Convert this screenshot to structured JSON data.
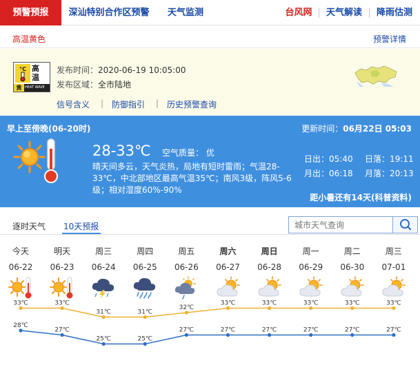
{
  "nav": {
    "items": [
      "预警预报",
      "深汕特别合作区预警",
      "天气监测",
      "台风网",
      "天气解读",
      "降雨估测"
    ]
  },
  "alert": {
    "tab": "高温黄色",
    "detail_link": "预警详情",
    "badge": {
      "title_line1": "高",
      "title_line2": "温",
      "level": "黄",
      "english": "HEAT WAVE",
      "therm": "°C"
    },
    "publish_time_label": "发布时间：",
    "publish_time": "2020-06-19 10:05:00",
    "area_label": "发布区域：",
    "area": "全市陆地",
    "links": [
      "信号含义",
      "防御指引",
      "历史预警查询"
    ]
  },
  "today": {
    "period": "早上至傍晚(06-20时)",
    "updated_label": "更新时间：",
    "updated": "06月22日 05:03",
    "temp": "28-33℃",
    "air_quality": "空气质量： 优",
    "description": "晴天间多云，天气炎热，局地有短时雷雨；气温28-33℃，中北部地区最高气温35℃；南风3级，阵风5-6级；相对湿度60%-90%",
    "sunrise": "日出：05:40",
    "sunset": "日落：19:11",
    "moonrise": "月出：06:18",
    "moonset": "月落：20:13",
    "tip": "距小暑还有14天(科普资料)"
  },
  "forecast": {
    "tabs": [
      "逐时天气",
      "10天预报"
    ],
    "search_placeholder": "城市天气查询",
    "days": [
      {
        "name": "今天",
        "date": "06-22",
        "icon": "sunny-hot-icon",
        "bold": false
      },
      {
        "name": "明天",
        "date": "06-23",
        "icon": "sunny-hot-icon",
        "bold": false
      },
      {
        "name": "周三",
        "date": "06-24",
        "icon": "thunderstorm-icon",
        "bold": false
      },
      {
        "name": "周四",
        "date": "06-25",
        "icon": "rain-icon",
        "bold": false
      },
      {
        "name": "周五",
        "date": "06-26",
        "icon": "partly-cloudy-shower-icon",
        "bold": false
      },
      {
        "name": "周六",
        "date": "06-27",
        "icon": "partly-cloudy-icon",
        "bold": true
      },
      {
        "name": "周日",
        "date": "06-28",
        "icon": "partly-cloudy-icon",
        "bold": true
      },
      {
        "name": "周一",
        "date": "06-29",
        "icon": "partly-cloudy-icon",
        "bold": false
      },
      {
        "name": "周二",
        "date": "06-30",
        "icon": "partly-cloudy-icon",
        "bold": false
      },
      {
        "name": "周三",
        "date": "07-01",
        "icon": "partly-cloudy-icon",
        "bold": false
      }
    ]
  },
  "chart_data": {
    "type": "line",
    "categories": [
      "06-22",
      "06-23",
      "06-24",
      "06-25",
      "06-26",
      "06-27",
      "06-28",
      "06-29",
      "06-30",
      "07-01"
    ],
    "series": [
      {
        "values": [
          33,
          33,
          31,
          31,
          32,
          33,
          33,
          33,
          33,
          33
        ],
        "color": "#f0b030",
        "unit": "℃"
      },
      {
        "values": [
          28,
          27,
          25,
          25,
          27,
          27,
          27,
          27,
          27,
          27
        ],
        "color": "#2f6fc6",
        "unit": "℃"
      }
    ]
  },
  "colors": {
    "brand_red": "#d7211f",
    "link_blue": "#1a4aa8",
    "panel_blue": "#3f8fdf",
    "alert_bg": "#fcfbe8"
  }
}
